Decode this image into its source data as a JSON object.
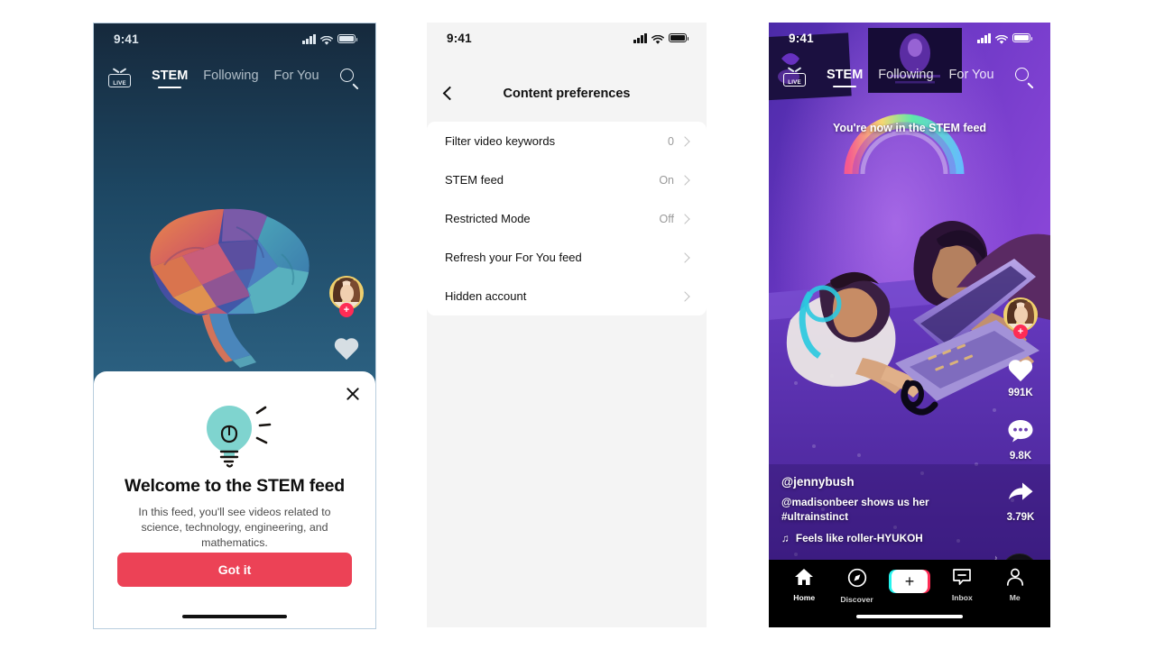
{
  "status_bar": {
    "time": "9:41",
    "signal_icon": "signal-bars-icon",
    "wifi_icon": "wifi-icon",
    "battery_icon": "battery-icon"
  },
  "panel1": {
    "name": "stem-feed-welcome-screen",
    "background_colors": {
      "top": "#16293c",
      "bottom": "#2f6588"
    },
    "nav": {
      "live_label": "LIVE",
      "tabs": [
        {
          "label": "STEM",
          "active": true
        },
        {
          "label": "Following",
          "active": false
        },
        {
          "label": "For You",
          "active": false
        }
      ],
      "search_icon": "search-icon"
    },
    "artwork": "low-poly-brain-illustration",
    "rail": {
      "avatar": "creator-avatar",
      "follow_badge": "+",
      "like_icon": "heart-icon"
    },
    "modal": {
      "close_icon": "close-icon",
      "illustration": "lightbulb-icon",
      "title": "Welcome to the STEM feed",
      "body": "In this feed, you'll see videos related to science, technology, engineering, and mathematics.",
      "cta_label": "Got it",
      "cta_color": "#ec4256"
    }
  },
  "panel2": {
    "name": "content-preferences-settings",
    "back_icon": "back-chevron-icon",
    "title": "Content preferences",
    "rows": [
      {
        "label": "Filter video keywords",
        "value": "0"
      },
      {
        "label": "STEM feed",
        "value": "On"
      },
      {
        "label": "Restricted Mode",
        "value": "Off"
      },
      {
        "label": "Refresh your For You feed",
        "value": ""
      },
      {
        "label": "Hidden account",
        "value": ""
      }
    ]
  },
  "panel3": {
    "name": "stem-feed-video-player",
    "nav": {
      "live_label": "LIVE",
      "tabs": [
        {
          "label": "STEM",
          "active": true
        },
        {
          "label": "Following",
          "active": false
        },
        {
          "label": "For You",
          "active": false
        }
      ],
      "search_icon": "search-icon"
    },
    "toast": "You're now in the STEM feed",
    "video": "teens-gaming-on-laptop-purple-neon-room",
    "rail": {
      "avatar": "creator-avatar",
      "follow_badge": "+",
      "like_icon": "heart-icon",
      "like_count": "991K",
      "comment_icon": "comment-icon",
      "comment_count": "9.8K",
      "share_icon": "share-icon",
      "share_count": "3.79K",
      "music_disc": "music-disc-icon"
    },
    "caption": {
      "username": "@jennybush",
      "description": "@madisonbeer shows us her #ultrainstinct",
      "music_icon": "music-note-icon",
      "music": "Feels like roller-HYUKOH"
    },
    "tabbar": [
      {
        "label": "Home",
        "icon": "home-icon"
      },
      {
        "label": "Discover",
        "icon": "compass-icon"
      },
      {
        "label": "",
        "icon": "create-plus-icon"
      },
      {
        "label": "Inbox",
        "icon": "inbox-icon"
      },
      {
        "label": "Me",
        "icon": "person-icon"
      }
    ]
  }
}
